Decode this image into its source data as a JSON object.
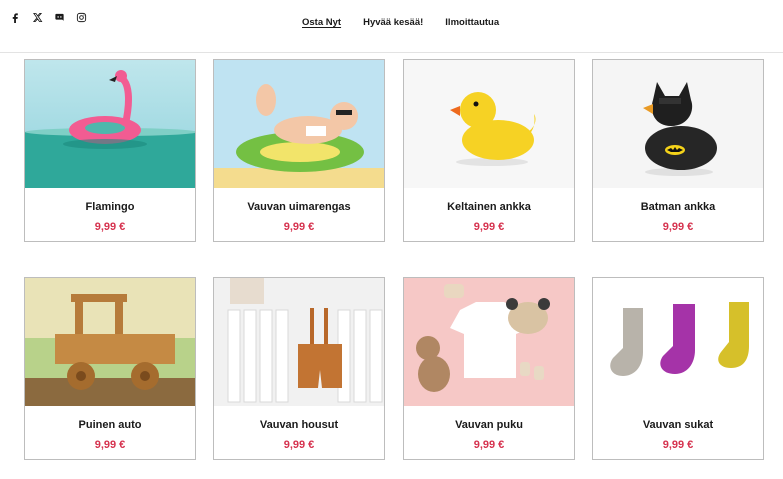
{
  "social": [
    {
      "icon": "facebook-icon"
    },
    {
      "icon": "x-twitter-icon"
    },
    {
      "icon": "discord-icon"
    },
    {
      "icon": "instagram-icon"
    }
  ],
  "nav": {
    "items": [
      {
        "label": "Osta Nyt",
        "active": true
      },
      {
        "label": "Hyvää kesää!",
        "active": false
      },
      {
        "label": "Ilmoittautua",
        "active": false
      }
    ]
  },
  "colors": {
    "price": "#d6334f",
    "border": "#bdbdbd",
    "text": "#1a1a1a"
  },
  "products": [
    {
      "name": "Flamingo",
      "price": "9,99 €",
      "image": "pink-flamingo-float-on-water"
    },
    {
      "name": "Vauvan uimarengas",
      "price": "9,99 €",
      "image": "baby-on-swim-ring"
    },
    {
      "name": "Keltainen ankka",
      "price": "9,99 €",
      "image": "yellow-rubber-duck"
    },
    {
      "name": "Batman ankka",
      "price": "9,99 €",
      "image": "batman-rubber-duck"
    },
    {
      "name": "Puinen auto",
      "price": "9,99 €",
      "image": "wooden-toy-car"
    },
    {
      "name": "Vauvan housut",
      "price": "9,99 €",
      "image": "baby-shorts-on-radiator"
    },
    {
      "name": "Vauvan puku",
      "price": "9,99 €",
      "image": "baby-outfit-flatlay"
    },
    {
      "name": "Vauvan sukat",
      "price": "9,99 €",
      "image": "baby-socks"
    }
  ]
}
